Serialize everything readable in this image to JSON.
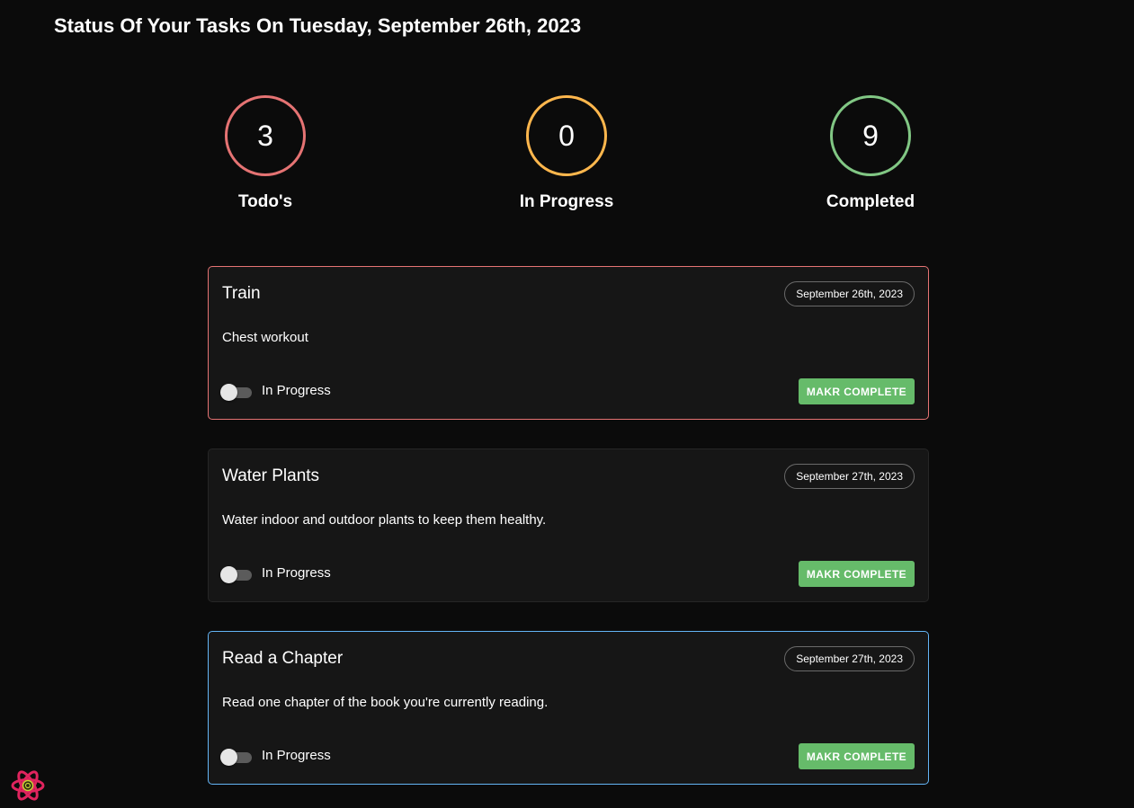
{
  "header": {
    "title": "Status Of Your Tasks On Tuesday, September 26th, 2023"
  },
  "stats": [
    {
      "label": "Todo's",
      "count": "3",
      "color": "#e57373"
    },
    {
      "label": "In Progress",
      "count": "0",
      "color": "#ffb74d"
    },
    {
      "label": "Completed",
      "count": "9",
      "color": "#81c784"
    }
  ],
  "tasks": [
    {
      "title": "Train",
      "date": "September 26th, 2023",
      "description": "Chest workout",
      "toggle_label": "In Progress",
      "button_label": "MAKR COMPLETE",
      "border_color": "#e57373"
    },
    {
      "title": "Water Plants",
      "date": "September 27th, 2023",
      "description": "Water indoor and outdoor plants to keep them healthy.",
      "toggle_label": "In Progress",
      "button_label": "MAKR COMPLETE",
      "border_color": "#262626"
    },
    {
      "title": "Read a Chapter",
      "date": "September 27th, 2023",
      "description": "Read one chapter of the book you're currently reading.",
      "toggle_label": "In Progress",
      "button_label": "MAKR COMPLETE",
      "border_color": "#64b5f6"
    }
  ],
  "colors": {
    "background": "#0b0b0b",
    "card_background": "#161616",
    "button_green": "#66bb6a"
  },
  "icons": {
    "devtools": "react-logo-icon"
  }
}
